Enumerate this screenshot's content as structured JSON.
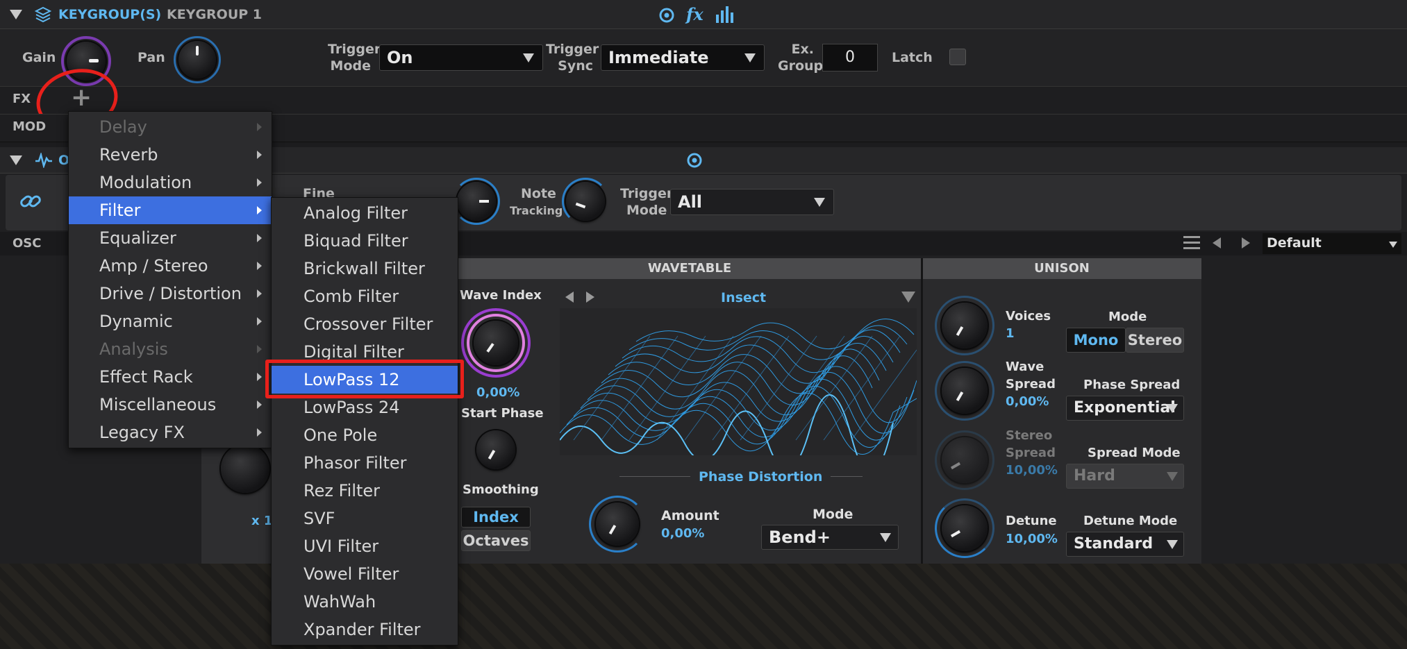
{
  "keygroup": {
    "title": "KEYGROUP(S)",
    "name": "KEYGROUP 1",
    "fx_label": "fx",
    "gain_label": "Gain",
    "pan_label": "Pan",
    "trigger_mode_label_1": "Trigger",
    "trigger_mode_label_2": "Mode",
    "trigger_mode_value": "On",
    "trigger_sync_label_1": "Trigger",
    "trigger_sync_label_2": "Sync",
    "trigger_sync_value": "Immediate",
    "ex_group_label_1": "Ex.",
    "ex_group_label_2": "Group",
    "ex_group_value": "0",
    "latch_label": "Latch",
    "fx_row_label": "FX",
    "add_symbol": "+",
    "mod_row_label": "MOD"
  },
  "oscillator": {
    "title_initial": "O",
    "fine_label": "Fine",
    "note_tracking_label_1": "Note",
    "note_tracking_label_2": "Tracking",
    "trigger_mode_label_1": "Trigger",
    "trigger_mode_label_2": "Mode",
    "trigger_mode_value": "All",
    "osc_tab_label": "OSC",
    "preset_value": "Default",
    "multiplier_label": "x 1"
  },
  "wavetable": {
    "section_title": "WAVETABLE",
    "wave_index_label": "Wave Index",
    "wave_index_value": "0,00%",
    "start_phase_label": "Start Phase",
    "smoothing_label": "Smoothing",
    "index_button": "Index",
    "octaves_button": "Octaves",
    "wavetable_name": "Insect",
    "phase_distortion_label": "Phase Distortion",
    "amount_label": "Amount",
    "amount_value": "0,00%",
    "mode_label": "Mode",
    "mode_value": "Bend+"
  },
  "unison": {
    "section_title": "UNISON",
    "voices_label": "Voices",
    "voices_value": "1",
    "mode_label": "Mode",
    "mode_mono": "Mono",
    "mode_stereo": "Stereo",
    "wave_spread_label_1": "Wave",
    "wave_spread_label_2": "Spread",
    "wave_spread_value": "0,00%",
    "phase_spread_label": "Phase Spread",
    "phase_spread_value": "Exponential",
    "stereo_spread_label_1": "Stereo",
    "stereo_spread_label_2": "Spread",
    "stereo_spread_value": "10,00%",
    "spread_mode_label": "Spread Mode",
    "spread_mode_value": "Hard",
    "detune_label": "Detune",
    "detune_value": "10,00%",
    "detune_mode_label": "Detune Mode",
    "detune_mode_value": "Standard"
  },
  "fx_menu": {
    "items": [
      {
        "label": "Delay",
        "disabled": true
      },
      {
        "label": "Reverb"
      },
      {
        "label": "Modulation"
      },
      {
        "label": "Filter",
        "selected": true
      },
      {
        "label": "Equalizer"
      },
      {
        "label": "Amp / Stereo"
      },
      {
        "label": "Drive / Distortion"
      },
      {
        "label": "Dynamic"
      },
      {
        "label": "Analysis",
        "disabled": true
      },
      {
        "label": "Effect Rack"
      },
      {
        "label": "Miscellaneous"
      },
      {
        "label": "Legacy FX"
      }
    ]
  },
  "filter_menu": {
    "items": [
      {
        "label": "Analog Filter"
      },
      {
        "label": "Biquad Filter"
      },
      {
        "label": "Brickwall Filter"
      },
      {
        "label": "Comb Filter"
      },
      {
        "label": "Crossover Filter"
      },
      {
        "label": "Digital Filter"
      },
      {
        "label": "LowPass 12",
        "selected": true
      },
      {
        "label": "LowPass 24"
      },
      {
        "label": "One Pole"
      },
      {
        "label": "Phasor Filter"
      },
      {
        "label": "Rez Filter"
      },
      {
        "label": "SVF"
      },
      {
        "label": "UVI Filter"
      },
      {
        "label": "Vowel Filter"
      },
      {
        "label": "WahWah"
      },
      {
        "label": "Xpander Filter"
      }
    ]
  }
}
